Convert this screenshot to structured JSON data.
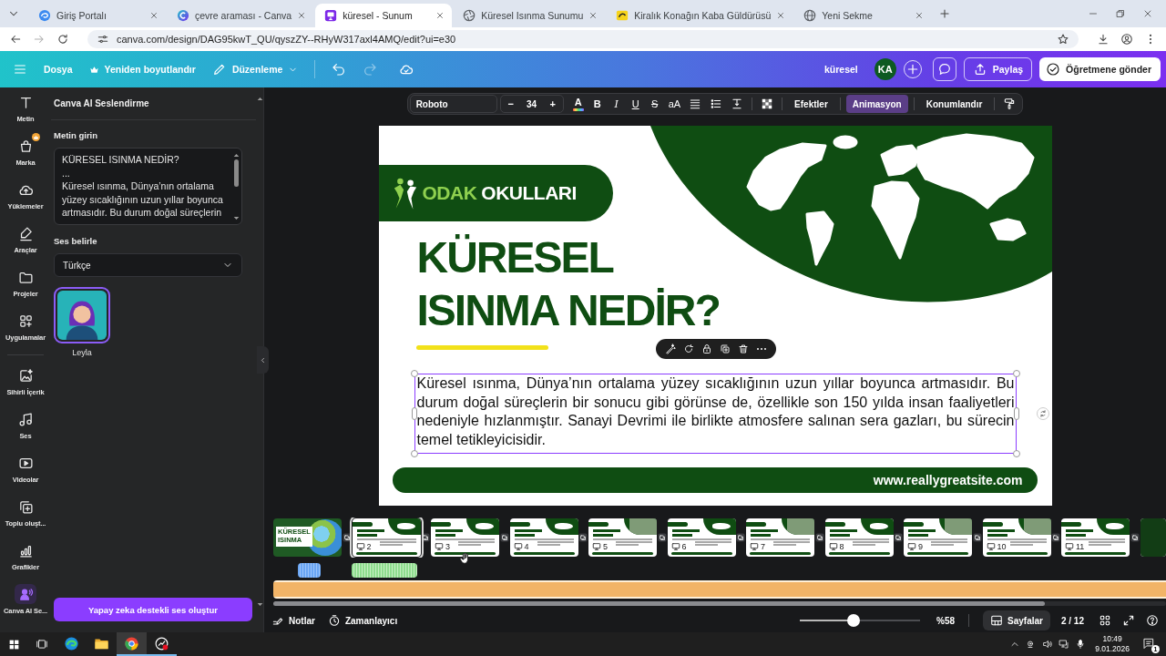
{
  "browser": {
    "tabs": [
      {
        "title": "Giriş Portalı",
        "kind": "swirl",
        "selected": false
      },
      {
        "title": "çevre araması - Canva",
        "kind": "ring",
        "selected": false
      },
      {
        "title": "küresel - Sunum",
        "kind": "slides",
        "selected": true
      },
      {
        "title": "Küresel Isınma Sunumu",
        "kind": "aperture",
        "selected": false
      },
      {
        "title": "Kiralık Konağın Kaba Güldürüsü",
        "kind": "tile",
        "selected": false
      },
      {
        "title": "Yeni Sekme",
        "kind": "globe",
        "selected": false
      }
    ],
    "url": "canva.com/design/DAG95kwT_QU/qyszZY--RHyW317axl4AMQ/edit?ui=e30"
  },
  "header": {
    "menu": [
      {
        "label": "Dosya",
        "kind": "plain"
      },
      {
        "label": "Yeniden boyutlandır",
        "kind": "crown"
      },
      {
        "label": "Düzenleme",
        "kind": "pencil"
      }
    ],
    "undo": {
      "disabled": false
    },
    "redo": {
      "disabled": true
    },
    "doc_title": "küresel",
    "avatar": "KA",
    "share": "Paylaş",
    "submit": "Öğretmene gönder"
  },
  "rail": {
    "top_items": [
      {
        "label": "Metin",
        "kind": "text",
        "selected": false,
        "premium": false
      },
      {
        "label": "Marka",
        "kind": "brand",
        "selected": false,
        "premium": true
      },
      {
        "label": "Yüklemeler",
        "kind": "uploads",
        "selected": false,
        "premium": false
      },
      {
        "label": "Araçlar",
        "kind": "tools",
        "selected": false,
        "premium": false
      },
      {
        "label": "Projeler",
        "kind": "projects",
        "selected": false,
        "premium": false
      },
      {
        "label": "Uygulamalar",
        "kind": "apps",
        "selected": false,
        "premium": false
      }
    ],
    "bottom_items": [
      {
        "label": "Sihirli İçerik",
        "kind": "magic",
        "selected": false,
        "premium": false
      },
      {
        "label": "Ses",
        "kind": "audio",
        "selected": false,
        "premium": false
      },
      {
        "label": "Videolar",
        "kind": "videos",
        "selected": false,
        "premium": false
      },
      {
        "label": "Toplu oluşt...",
        "kind": "bulk",
        "selected": false,
        "premium": false
      },
      {
        "label": "Grafikler",
        "kind": "charts",
        "selected": false,
        "premium": false
      },
      {
        "label": "Canva AI Se...",
        "kind": "voice",
        "selected": true,
        "premium": false
      }
    ]
  },
  "panel": {
    "title": "Canva AI Seslendirme",
    "text_label": "Metin girin",
    "text_value": "KÜRESEL ISINMA NEDİR?\n...\nKüresel ısınma, Dünya’nın ortalama yüzey sıcaklığının uzun yıllar boyunca artmasıdır. Bu durum doğal süreçlerin",
    "voice_label": "Ses belirle",
    "language": "Türkçe",
    "voices": [
      {
        "name": "Leyla",
        "selected": true
      }
    ],
    "generate_button": "Yapay zeka destekli ses oluştur"
  },
  "format_toolbar": {
    "font": "Roboto",
    "decrease": "−",
    "size": "34",
    "increase": "+",
    "color_glyph": "A",
    "styles": [
      {
        "kind": "bold",
        "glyph": "B"
      },
      {
        "kind": "italic",
        "glyph": "I"
      },
      {
        "kind": "underline",
        "glyph": "U"
      },
      {
        "kind": "strike",
        "glyph": "S"
      },
      {
        "kind": "case",
        "glyph": "aA"
      }
    ],
    "menu_buttons": [
      {
        "label": "Efektler",
        "selected": false
      },
      {
        "label": "Animasyon",
        "selected": true
      },
      {
        "label": "Konumlandır",
        "selected": false
      }
    ]
  },
  "slide": {
    "logo_accent": "ODAK",
    "logo_text": "OKULLARI",
    "title_lines": [
      "KÜRESEL",
      "ISINMA NEDİR?"
    ],
    "body": "Küresel ısınma, Dünya’nın ortalama yüzey sıcaklığının uzun yıllar boyunca artmasıdır. Bu durum doğal süreçlerin bir sonucu gibi görünse de, özellikle son 150 yılda insan faaliyetleri nedeniyle hızlanmıştır. Sanayi Devrimi ile birlikte atmosfere salınan sera gazları, bu sürecin temel tetikleyicisidir.",
    "body_selected": true,
    "website": "www.reallygreatsite.com"
  },
  "timeline": {
    "pages": [
      {
        "kind": "cover",
        "title": "KÜRESEL ISINMA",
        "selected": false
      },
      {
        "kind": "map",
        "page": "2",
        "selected": true
      },
      {
        "kind": "map",
        "page": "3",
        "selected": false
      },
      {
        "kind": "map",
        "page": "4",
        "selected": false
      },
      {
        "kind": "photo",
        "page": "5",
        "selected": false
      },
      {
        "kind": "map",
        "page": "6",
        "selected": false
      },
      {
        "kind": "photo",
        "page": "7",
        "selected": false
      },
      {
        "kind": "map",
        "page": "8",
        "selected": false
      },
      {
        "kind": "photo",
        "page": "9",
        "selected": false
      },
      {
        "kind": "photo",
        "page": "10",
        "selected": false
      },
      {
        "kind": "map",
        "page": "11",
        "selected": false
      },
      {
        "kind": "dark",
        "selected": false
      }
    ]
  },
  "bottom_bar": {
    "notes": "Notlar",
    "timer": "Zamanlayıcı",
    "zoom": {
      "level": 0.45,
      "reading": "%58"
    },
    "pages_button": "Sayfalar",
    "page_count": "2 / 12"
  },
  "taskbar": {
    "apps": [
      {
        "kind": "edge",
        "active": false,
        "running": false
      },
      {
        "kind": "folder",
        "active": false,
        "running": false
      },
      {
        "kind": "chrome",
        "active": true,
        "running": true
      },
      {
        "kind": "recorder",
        "active": false,
        "running": true
      }
    ],
    "time": "10:49",
    "date": "9.01.2026",
    "notifications": "1"
  }
}
